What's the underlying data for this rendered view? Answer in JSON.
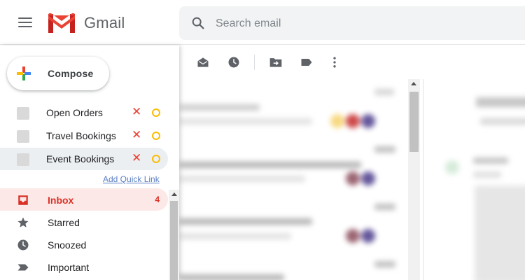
{
  "app": {
    "name": "Gmail"
  },
  "search": {
    "placeholder": "Search email"
  },
  "compose": {
    "label": "Compose"
  },
  "quick_links": [
    {
      "label": "Open Orders",
      "active": false
    },
    {
      "label": "Travel Bookings",
      "active": false
    },
    {
      "label": "Event Bookings",
      "active": true
    }
  ],
  "add_quick_link": "Add Quick Link",
  "nav": [
    {
      "label": "Inbox",
      "count": "4",
      "icon": "inbox-icon",
      "active": true
    },
    {
      "label": "Starred",
      "count": "",
      "icon": "star-icon",
      "active": false
    },
    {
      "label": "Snoozed",
      "count": "",
      "icon": "clock-icon",
      "active": false
    },
    {
      "label": "Important",
      "count": "",
      "icon": "important-icon",
      "active": false
    }
  ],
  "toolbar_icons": [
    "mark-read-icon",
    "snooze-icon",
    "move-to-icon",
    "label-icon",
    "more-options-icon"
  ],
  "colors": {
    "inbox_active_bg": "#fce8e6",
    "inbox_active_text": "#d93025",
    "quick_link_remove": "#ea4335",
    "quick_link_edit": "#fbbc04",
    "add_link": "#5b7fc3"
  }
}
